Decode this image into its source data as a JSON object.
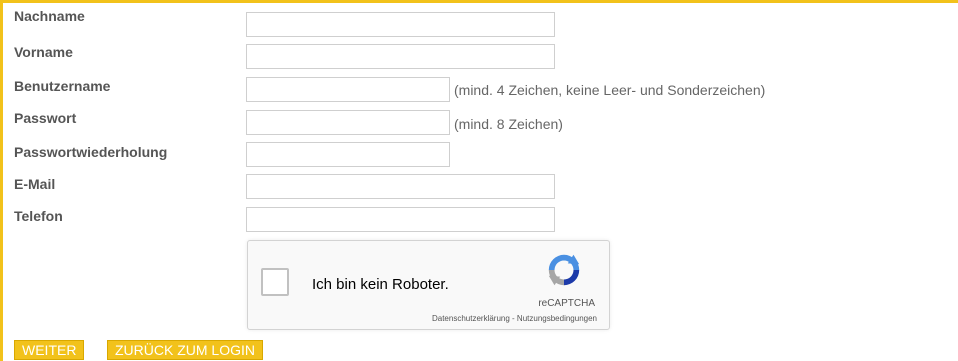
{
  "form": {
    "fields": [
      {
        "label": "Nachname",
        "value": "",
        "hint": ""
      },
      {
        "label": "Vorname",
        "value": "",
        "hint": ""
      },
      {
        "label": "Benutzername",
        "value": "",
        "hint": "(mind. 4 Zeichen, keine Leer- und Sonderzeichen)"
      },
      {
        "label": "Passwort",
        "value": "",
        "hint": "(mind. 8 Zeichen)"
      },
      {
        "label": "Passwortwiederholung",
        "value": "",
        "hint": ""
      },
      {
        "label": "E-Mail",
        "value": "",
        "hint": ""
      },
      {
        "label": "Telefon",
        "value": "",
        "hint": ""
      }
    ]
  },
  "captcha": {
    "checkbox_label": "Ich bin kein Roboter.",
    "brand": "reCAPTCHA",
    "privacy_link": "Datenschutzerklärung",
    "separator": " - ",
    "terms_link": "Nutzungsbedingungen",
    "logo_icon": "recaptcha-logo-icon"
  },
  "buttons": {
    "next": "WEITER",
    "back_to_login": "ZURÜCK ZUM LOGIN"
  },
  "colors": {
    "accent": "#f2c21b",
    "label_text": "#555555"
  }
}
